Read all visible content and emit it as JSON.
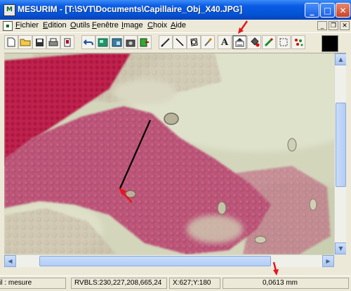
{
  "window": {
    "app_name": "MESURIM",
    "title": "MESURIM - [T:\\SVT\\Documents\\Capillaire_Obj_X40.JPG]",
    "minimize_glyph": "_",
    "maximize_glyph": "□",
    "close_glyph": "✕"
  },
  "menu": {
    "items": [
      "Fichier",
      "Edition",
      "Outils",
      "Fenêtre",
      "Image",
      "Choix",
      "Aide"
    ],
    "mdi_minimize_glyph": "_",
    "mdi_restore_glyph": "❐",
    "mdi_close_glyph": "✕"
  },
  "toolbar": {
    "text_tool_glyph": "A",
    "selected_tool": "scale-calibration-tool",
    "current_color": "#000000"
  },
  "canvas": {
    "image_content": "micrograph"
  },
  "status": {
    "tool": "Outil : mesure",
    "color_readout": "RVBLS:230,227,208,665,24",
    "coords": "X:627;Y:180",
    "measure": "0,0613 mm"
  },
  "colors": {
    "annotation_arrows": "#e8141c",
    "measure_line": "#000000",
    "titlebar": "#0454d8"
  }
}
